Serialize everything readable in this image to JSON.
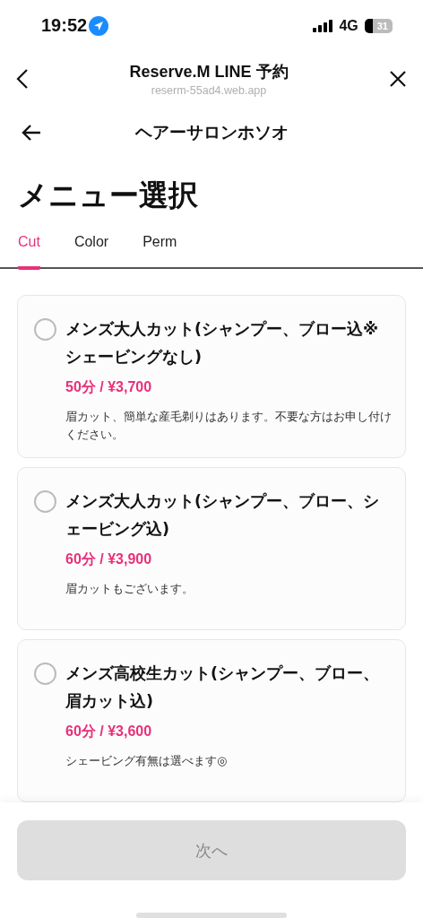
{
  "status_bar": {
    "time": "19:52",
    "network": "4G",
    "battery": "31"
  },
  "browser_bar": {
    "title": "Reserve.M LINE 予約",
    "url": "reserm-55ad4.web.app"
  },
  "page_header": {
    "title": "ヘアーサロンホソオ"
  },
  "heading": "メニュー選択",
  "tabs": [
    {
      "label": "Cut",
      "selected": true
    },
    {
      "label": "Color",
      "selected": false
    },
    {
      "label": "Perm",
      "selected": false
    }
  ],
  "menu_items": [
    {
      "name": "メンズ大人カット(シャンプー、ブロー込※シェービングなし)",
      "price": "50分 / ¥3,700",
      "description": "眉カット、簡単な産毛剃りはあります。不要な方はお申し付けください。",
      "selected": false
    },
    {
      "name": "メンズ大人カット(シャンプー、ブロー、シェービング込)",
      "price": "60分 / ¥3,900",
      "description": "眉カットもございます。",
      "selected": false
    },
    {
      "name": "メンズ高校生カット(シャンプー、ブロー、眉カット込)",
      "price": "60分 / ¥3,600",
      "description": "シェービング有無は選べます◎",
      "selected": false
    }
  ],
  "next_button": {
    "label": "次へ",
    "disabled": true
  }
}
